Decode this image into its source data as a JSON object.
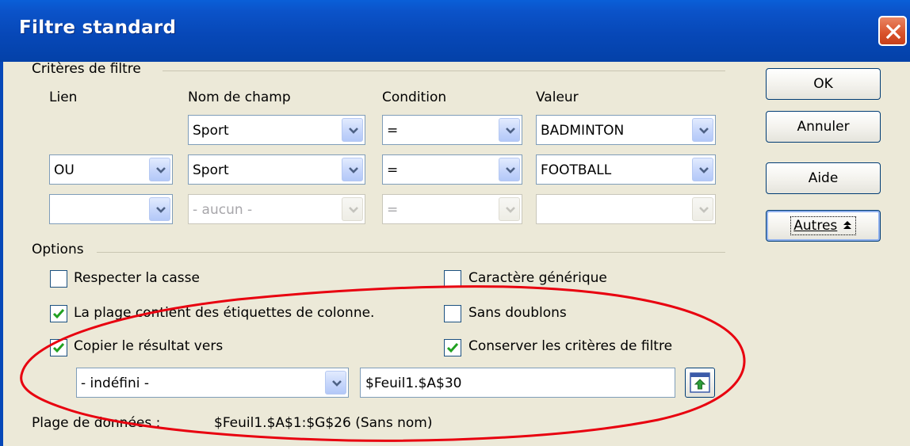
{
  "window": {
    "title": "Filtre standard"
  },
  "criteria": {
    "group_label": "Critères de filtre",
    "headers": {
      "link": "Lien",
      "field": "Nom de champ",
      "condition": "Condition",
      "value": "Valeur"
    },
    "rows": [
      {
        "link": "",
        "field": "Sport",
        "condition": "=",
        "value": "BADMINTON"
      },
      {
        "link": "OU",
        "field": "Sport",
        "condition": "=",
        "value": "FOOTBALL"
      },
      {
        "link": "",
        "field": "- aucun -",
        "condition": "=",
        "value": ""
      }
    ]
  },
  "buttons": {
    "ok": "OK",
    "cancel": "Annuler",
    "help": "Aide",
    "more": "Autres"
  },
  "options": {
    "group_label": "Options",
    "case_sensitive": {
      "label": "Respecter la casse",
      "checked": false
    },
    "contains_headers": {
      "label": "La plage contient des étiquettes de colonne.",
      "checked": true
    },
    "copy_results": {
      "label": "Copier le résultat vers",
      "checked": true
    },
    "regex": {
      "label": "Caractère générique",
      "checked": false
    },
    "no_duplicates": {
      "label": "Sans doublons",
      "checked": false
    },
    "keep_criteria": {
      "label": "Conserver les critères de filtre",
      "checked": true
    },
    "copy_target_combo": "- indéfini -",
    "copy_target_field": "$Feuil1.$A$30"
  },
  "data_range": {
    "label": "Plage de données :",
    "value": "$Feuil1.$A$1:$G$26 (Sans nom)"
  },
  "colors": {
    "title_bar": "#0748b8",
    "dialog_bg": "#ece9d8",
    "annotation": "#e8000f",
    "check": "#21a121"
  }
}
